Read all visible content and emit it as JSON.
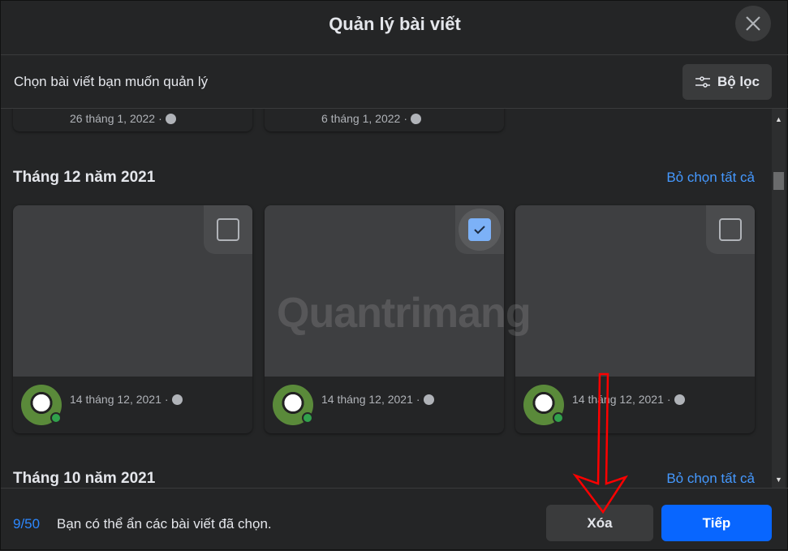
{
  "header": {
    "title": "Quản lý bài viết",
    "close_icon": "close-icon"
  },
  "subheader": {
    "text": "Chọn bài viết bạn muốn quản lý",
    "filter_label": "Bộ lọc",
    "filter_icon": "sliders-icon"
  },
  "top_partial_cards": [
    {
      "date": "26 tháng 1, 2022"
    },
    {
      "date": "6 tháng 1, 2022"
    }
  ],
  "sections": [
    {
      "title": "Tháng 12 năm 2021",
      "deselect_label": "Bỏ chọn tất cả",
      "cards": [
        {
          "date": "14 tháng 12, 2021",
          "checked": false
        },
        {
          "date": "14 tháng 12, 2021",
          "checked": true
        },
        {
          "date": "14 tháng 12, 2021",
          "checked": false
        }
      ]
    },
    {
      "title": "Tháng 10 năm 2021",
      "deselect_label": "Bỏ chọn tất cả"
    }
  ],
  "footer": {
    "count": "9/50",
    "text": "Bạn có thể ẩn các bài viết đã chọn.",
    "delete_label": "Xóa",
    "next_label": "Tiếp"
  },
  "watermark": "Quantrimang",
  "colors": {
    "accent": "#0866ff",
    "link": "#4599ff",
    "online": "#31a24c",
    "annotation_arrow": "#ff0000"
  }
}
